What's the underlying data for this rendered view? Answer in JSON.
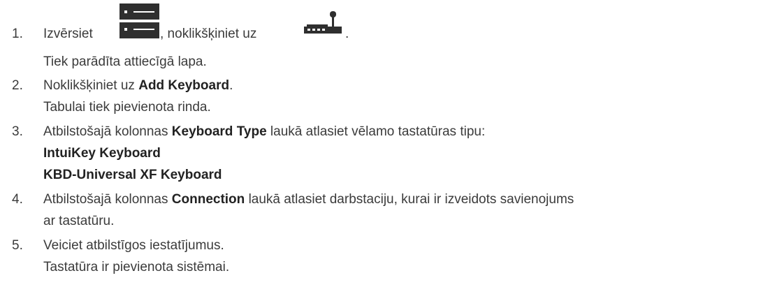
{
  "steps": [
    {
      "number": "1.",
      "text_before": "Izvērsiet",
      "text_middle": ", noklikšķiniet uz",
      "text_end": ".",
      "icon_1": "server-device-icon",
      "icon_2": "keyboard-device-icon",
      "result": "Tiek parādīta attiecīgā lapa."
    },
    {
      "number": "2.",
      "text_before": "Noklikšķiniet uz",
      "bold": "Add Keyboard",
      "text_after": ".",
      "result": "Tabulai tiek pievienota rinda."
    },
    {
      "number": "3.",
      "text_before": "Atbilstošajā kolonnas",
      "bold": "Keyboard Type",
      "text_after": "laukā atlasiet vēlamo tastatūras tipu:",
      "options": [
        "IntuiKey Keyboard",
        "KBD-Universal XF Keyboard"
      ]
    },
    {
      "number": "4.",
      "text_before": "Atbilstošajā kolonnas",
      "bold": "Connection",
      "text_after": "laukā atlasiet darbstaciju, kurai ir izveidots savienojums",
      "continuation": "ar tastatūru."
    },
    {
      "number": "5.",
      "text_before": "Veiciet atbilstīgos iestatījumus.",
      "result": "Tastatūra ir pievienota sistēmai."
    }
  ]
}
